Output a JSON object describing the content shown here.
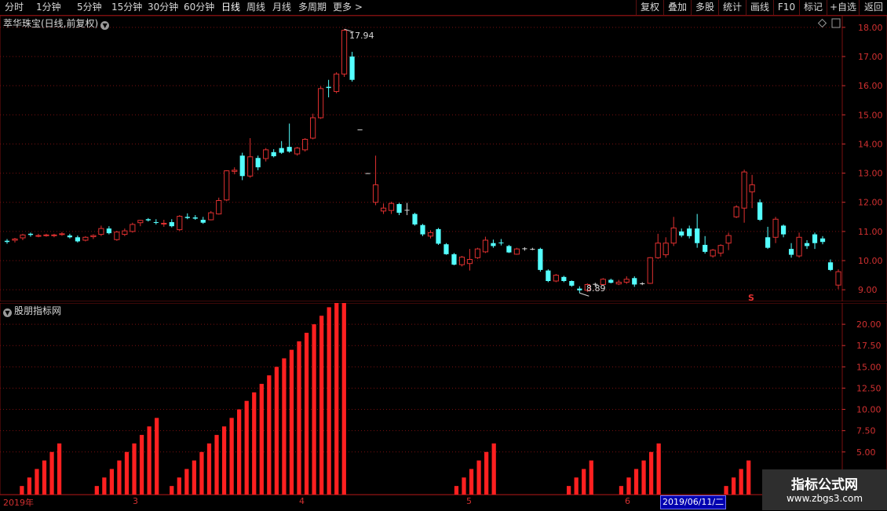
{
  "toolbar": {
    "periods": [
      "分时",
      "1分钟",
      "5分钟",
      "15分钟",
      "30分钟",
      "60分钟",
      "日线",
      "周线",
      "月线",
      "多周期",
      "更多 >"
    ],
    "active_period": "日线",
    "right_buttons": [
      "复权",
      "叠加",
      "多股",
      "统计",
      "画线",
      "F10",
      "标记",
      "+自选",
      "返回"
    ]
  },
  "main_panel": {
    "title": "萃华珠宝(日线,前复权)",
    "high_label": "17.94",
    "low_label": "8.89",
    "signal_mark": "S"
  },
  "indicator_panel": {
    "title": "股朋指标网"
  },
  "date_axis": {
    "labels": [
      "2019年",
      "3",
      "4",
      "5",
      "6"
    ],
    "cursor_date": "2019/06/11/二"
  },
  "watermark": {
    "line1": "指标公式网",
    "line2": "www.zbgs3.com"
  },
  "colors": {
    "up": "#e03030",
    "down": "#54ffff",
    "grid": "#7a1010",
    "axis_text": "#d03030",
    "indicator_bar": "#ff2020"
  },
  "chart_data": [
    {
      "type": "candlestick",
      "ylim": [
        8.6,
        18.4
      ],
      "y_ticks": [
        "18.00",
        "17.00",
        "16.00",
        "15.00",
        "14.00",
        "13.00",
        "12.00",
        "11.00",
        "10.00",
        "9.00"
      ],
      "candles": [
        {
          "o": 10.64,
          "h": 10.74,
          "l": 10.58,
          "c": 10.68,
          "dir": "down"
        },
        {
          "o": 10.7,
          "h": 10.78,
          "l": 10.62,
          "c": 10.74,
          "dir": "up"
        },
        {
          "o": 10.78,
          "h": 10.92,
          "l": 10.7,
          "c": 10.88,
          "dir": "up"
        },
        {
          "o": 10.92,
          "h": 10.96,
          "l": 10.82,
          "c": 10.88,
          "dir": "down"
        },
        {
          "o": 10.86,
          "h": 10.92,
          "l": 10.8,
          "c": 10.86,
          "dir": "up"
        },
        {
          "o": 10.88,
          "h": 10.92,
          "l": 10.82,
          "c": 10.88,
          "dir": "up"
        },
        {
          "o": 10.86,
          "h": 10.92,
          "l": 10.8,
          "c": 10.88,
          "dir": "up"
        },
        {
          "o": 10.92,
          "h": 10.98,
          "l": 10.85,
          "c": 10.9,
          "dir": "up"
        },
        {
          "o": 10.86,
          "h": 10.92,
          "l": 10.76,
          "c": 10.8,
          "dir": "down"
        },
        {
          "o": 10.66,
          "h": 10.86,
          "l": 10.62,
          "c": 10.8,
          "dir": "down"
        },
        {
          "o": 10.7,
          "h": 10.84,
          "l": 10.66,
          "c": 10.8,
          "dir": "up"
        },
        {
          "o": 10.82,
          "h": 10.9,
          "l": 10.74,
          "c": 10.86,
          "dir": "up"
        },
        {
          "o": 10.9,
          "h": 11.2,
          "l": 10.84,
          "c": 11.1,
          "dir": "up"
        },
        {
          "o": 11.1,
          "h": 11.18,
          "l": 10.9,
          "c": 10.94,
          "dir": "down"
        },
        {
          "o": 10.72,
          "h": 11.02,
          "l": 10.68,
          "c": 10.98,
          "dir": "up"
        },
        {
          "o": 10.9,
          "h": 11.1,
          "l": 10.84,
          "c": 11.02,
          "dir": "up"
        },
        {
          "o": 11.0,
          "h": 11.3,
          "l": 10.96,
          "c": 11.24,
          "dir": "up"
        },
        {
          "o": 11.3,
          "h": 11.4,
          "l": 11.18,
          "c": 11.38,
          "dir": "up"
        },
        {
          "o": 11.42,
          "h": 11.46,
          "l": 11.34,
          "c": 11.38,
          "dir": "down"
        },
        {
          "o": 11.32,
          "h": 11.42,
          "l": 11.24,
          "c": 11.32,
          "dir": "down"
        },
        {
          "o": 11.26,
          "h": 11.4,
          "l": 11.16,
          "c": 11.28,
          "dir": "up"
        },
        {
          "o": 11.32,
          "h": 11.42,
          "l": 11.14,
          "c": 11.18,
          "dir": "down"
        },
        {
          "o": 11.06,
          "h": 11.56,
          "l": 11.02,
          "c": 11.52,
          "dir": "up"
        },
        {
          "o": 11.5,
          "h": 11.62,
          "l": 11.42,
          "c": 11.46,
          "dir": "down"
        },
        {
          "o": 11.48,
          "h": 11.56,
          "l": 11.4,
          "c": 11.44,
          "dir": "down"
        },
        {
          "o": 11.3,
          "h": 11.5,
          "l": 11.26,
          "c": 11.4,
          "dir": "down"
        },
        {
          "o": 11.4,
          "h": 11.7,
          "l": 11.38,
          "c": 11.64,
          "dir": "up"
        },
        {
          "o": 11.6,
          "h": 12.16,
          "l": 11.58,
          "c": 12.06,
          "dir": "up"
        },
        {
          "o": 12.08,
          "h": 13.1,
          "l": 12.04,
          "c": 13.08,
          "dir": "up"
        },
        {
          "o": 13.06,
          "h": 13.2,
          "l": 12.96,
          "c": 13.1,
          "dir": "up"
        },
        {
          "o": 13.6,
          "h": 13.7,
          "l": 12.76,
          "c": 12.9,
          "dir": "down"
        },
        {
          "o": 12.9,
          "h": 14.2,
          "l": 12.84,
          "c": 13.56,
          "dir": "up"
        },
        {
          "o": 13.52,
          "h": 13.6,
          "l": 13.1,
          "c": 13.2,
          "dir": "down"
        },
        {
          "o": 13.5,
          "h": 13.86,
          "l": 13.4,
          "c": 13.8,
          "dir": "up"
        },
        {
          "o": 13.72,
          "h": 13.82,
          "l": 13.54,
          "c": 13.58,
          "dir": "down"
        },
        {
          "o": 13.7,
          "h": 14.1,
          "l": 13.66,
          "c": 13.86,
          "dir": "down"
        },
        {
          "o": 13.9,
          "h": 14.7,
          "l": 13.7,
          "c": 13.74,
          "dir": "down"
        },
        {
          "o": 13.66,
          "h": 13.9,
          "l": 13.6,
          "c": 13.86,
          "dir": "up"
        },
        {
          "o": 13.8,
          "h": 14.2,
          "l": 13.74,
          "c": 14.16,
          "dir": "up"
        },
        {
          "o": 14.2,
          "h": 15.04,
          "l": 14.16,
          "c": 14.9,
          "dir": "up"
        },
        {
          "o": 14.9,
          "h": 15.98,
          "l": 14.86,
          "c": 15.9,
          "dir": "up"
        },
        {
          "o": 15.92,
          "h": 16.2,
          "l": 15.6,
          "c": 15.96,
          "dir": "down"
        },
        {
          "o": 15.8,
          "h": 16.46,
          "l": 15.74,
          "c": 16.4,
          "dir": "up"
        },
        {
          "o": 16.4,
          "h": 17.94,
          "l": 16.3,
          "c": 17.9,
          "dir": "up"
        },
        {
          "o": 17.0,
          "h": 17.16,
          "l": 16.14,
          "c": 16.2,
          "dir": "down"
        },
        {
          "o": 14.5,
          "h": 14.5,
          "l": 14.5,
          "c": 14.5,
          "dir": "doji"
        },
        {
          "o": 13.0,
          "h": 13.0,
          "l": 13.0,
          "c": 13.0,
          "dir": "doji"
        },
        {
          "o": 12.0,
          "h": 13.6,
          "l": 11.9,
          "c": 12.6,
          "dir": "up"
        },
        {
          "o": 11.8,
          "h": 11.96,
          "l": 11.6,
          "c": 11.7,
          "dir": "up"
        },
        {
          "o": 11.72,
          "h": 12.02,
          "l": 11.6,
          "c": 11.96,
          "dir": "up"
        },
        {
          "o": 11.94,
          "h": 11.98,
          "l": 11.56,
          "c": 11.64,
          "dir": "down"
        },
        {
          "o": 11.74,
          "h": 11.98,
          "l": 11.56,
          "c": 11.74,
          "dir": "doji"
        },
        {
          "o": 11.6,
          "h": 11.64,
          "l": 11.2,
          "c": 11.24,
          "dir": "down"
        },
        {
          "o": 11.22,
          "h": 11.26,
          "l": 10.84,
          "c": 10.9,
          "dir": "down"
        },
        {
          "o": 10.84,
          "h": 11.04,
          "l": 10.76,
          "c": 10.96,
          "dir": "up"
        },
        {
          "o": 11.08,
          "h": 11.12,
          "l": 10.54,
          "c": 10.58,
          "dir": "down"
        },
        {
          "o": 10.56,
          "h": 10.6,
          "l": 10.2,
          "c": 10.22,
          "dir": "down"
        },
        {
          "o": 10.22,
          "h": 10.26,
          "l": 9.84,
          "c": 9.86,
          "dir": "down"
        },
        {
          "o": 9.86,
          "h": 10.16,
          "l": 9.8,
          "c": 10.12,
          "dir": "up"
        },
        {
          "o": 9.9,
          "h": 10.4,
          "l": 9.66,
          "c": 10.04,
          "dir": "up"
        },
        {
          "o": 10.1,
          "h": 10.44,
          "l": 10.06,
          "c": 10.4,
          "dir": "up"
        },
        {
          "o": 10.3,
          "h": 10.82,
          "l": 10.26,
          "c": 10.7,
          "dir": "up"
        },
        {
          "o": 10.6,
          "h": 10.72,
          "l": 10.44,
          "c": 10.5,
          "dir": "down"
        },
        {
          "o": 10.62,
          "h": 10.74,
          "l": 10.52,
          "c": 10.6,
          "dir": "down"
        },
        {
          "o": 10.5,
          "h": 10.54,
          "l": 10.26,
          "c": 10.28,
          "dir": "down"
        },
        {
          "o": 10.22,
          "h": 10.44,
          "l": 10.2,
          "c": 10.4,
          "dir": "up"
        },
        {
          "o": 10.4,
          "h": 10.46,
          "l": 10.34,
          "c": 10.42,
          "dir": "doji"
        },
        {
          "o": 10.4,
          "h": 10.44,
          "l": 10.36,
          "c": 10.4,
          "dir": "doji"
        },
        {
          "o": 10.4,
          "h": 10.44,
          "l": 9.62,
          "c": 9.68,
          "dir": "down"
        },
        {
          "o": 9.66,
          "h": 9.7,
          "l": 9.26,
          "c": 9.3,
          "dir": "down"
        },
        {
          "o": 9.3,
          "h": 9.54,
          "l": 9.26,
          "c": 9.5,
          "dir": "up"
        },
        {
          "o": 9.44,
          "h": 9.48,
          "l": 9.26,
          "c": 9.3,
          "dir": "down"
        },
        {
          "o": 9.3,
          "h": 9.32,
          "l": 9.1,
          "c": 9.14,
          "dir": "down"
        },
        {
          "o": 9.04,
          "h": 9.12,
          "l": 8.89,
          "c": 8.98,
          "dir": "down"
        },
        {
          "o": 8.98,
          "h": 9.22,
          "l": 8.92,
          "c": 9.18,
          "dir": "up"
        },
        {
          "o": 9.18,
          "h": 9.24,
          "l": 9.12,
          "c": 9.2,
          "dir": "doji"
        },
        {
          "o": 9.18,
          "h": 9.4,
          "l": 9.14,
          "c": 9.36,
          "dir": "up"
        },
        {
          "o": 9.34,
          "h": 9.38,
          "l": 9.22,
          "c": 9.24,
          "dir": "down"
        },
        {
          "o": 9.2,
          "h": 9.34,
          "l": 9.16,
          "c": 9.26,
          "dir": "up"
        },
        {
          "o": 9.26,
          "h": 9.46,
          "l": 9.2,
          "c": 9.36,
          "dir": "up"
        },
        {
          "o": 9.4,
          "h": 9.46,
          "l": 9.1,
          "c": 9.18,
          "dir": "down"
        },
        {
          "o": 9.22,
          "h": 9.26,
          "l": 9.16,
          "c": 9.22,
          "dir": "doji"
        },
        {
          "o": 9.22,
          "h": 10.12,
          "l": 9.2,
          "c": 10.1,
          "dir": "up"
        },
        {
          "o": 10.1,
          "h": 10.92,
          "l": 10.06,
          "c": 10.6,
          "dir": "up"
        },
        {
          "o": 10.2,
          "h": 10.8,
          "l": 10.1,
          "c": 10.6,
          "dir": "up"
        },
        {
          "o": 10.6,
          "h": 11.5,
          "l": 10.5,
          "c": 11.12,
          "dir": "up"
        },
        {
          "o": 11.0,
          "h": 11.1,
          "l": 10.8,
          "c": 10.86,
          "dir": "down"
        },
        {
          "o": 11.1,
          "h": 11.2,
          "l": 10.76,
          "c": 10.84,
          "dir": "down"
        },
        {
          "o": 11.1,
          "h": 11.6,
          "l": 10.44,
          "c": 10.6,
          "dir": "down"
        },
        {
          "o": 10.54,
          "h": 10.84,
          "l": 10.24,
          "c": 10.3,
          "dir": "down"
        },
        {
          "o": 10.16,
          "h": 10.4,
          "l": 10.1,
          "c": 10.36,
          "dir": "up"
        },
        {
          "o": 10.26,
          "h": 10.56,
          "l": 10.14,
          "c": 10.52,
          "dir": "up"
        },
        {
          "o": 10.6,
          "h": 10.96,
          "l": 10.36,
          "c": 10.86,
          "dir": "up"
        },
        {
          "o": 11.5,
          "h": 11.9,
          "l": 11.46,
          "c": 11.84,
          "dir": "up"
        },
        {
          "o": 11.8,
          "h": 13.12,
          "l": 11.3,
          "c": 13.04,
          "dir": "up"
        },
        {
          "o": 12.6,
          "h": 12.94,
          "l": 11.8,
          "c": 12.36,
          "dir": "up"
        },
        {
          "o": 12.0,
          "h": 12.1,
          "l": 11.36,
          "c": 11.4,
          "dir": "down"
        },
        {
          "o": 10.8,
          "h": 11.16,
          "l": 10.4,
          "c": 10.44,
          "dir": "down"
        },
        {
          "o": 10.8,
          "h": 11.5,
          "l": 10.6,
          "c": 11.42,
          "dir": "up"
        },
        {
          "o": 11.2,
          "h": 11.24,
          "l": 10.8,
          "c": 10.9,
          "dir": "down"
        },
        {
          "o": 10.4,
          "h": 10.6,
          "l": 10.1,
          "c": 10.2,
          "dir": "down"
        },
        {
          "o": 10.16,
          "h": 10.96,
          "l": 10.1,
          "c": 10.8,
          "dir": "up"
        },
        {
          "o": 10.6,
          "h": 10.7,
          "l": 10.4,
          "c": 10.5,
          "dir": "down"
        },
        {
          "o": 10.6,
          "h": 10.96,
          "l": 10.4,
          "c": 10.9,
          "dir": "down"
        },
        {
          "o": 10.76,
          "h": 10.84,
          "l": 10.56,
          "c": 10.64,
          "dir": "down"
        },
        {
          "o": 9.94,
          "h": 10.04,
          "l": 9.64,
          "c": 9.68,
          "dir": "down"
        },
        {
          "o": 9.16,
          "h": 9.7,
          "l": 9.02,
          "c": 9.62,
          "dir": "up"
        }
      ]
    },
    {
      "type": "bar",
      "ylim": [
        0,
        22.5
      ],
      "y_ticks": [
        "20.00",
        "17.50",
        "15.00",
        "12.50",
        "10.00",
        "7.50",
        "5.00"
      ],
      "values": [
        0,
        0,
        1,
        2,
        3,
        4,
        5,
        6,
        0,
        0,
        0,
        0,
        1,
        2,
        3,
        4,
        5,
        6,
        7,
        8,
        9,
        0,
        1,
        2,
        3,
        4,
        5,
        6,
        7,
        8,
        9,
        10,
        11,
        12,
        13,
        14,
        15,
        16,
        17,
        18,
        19,
        20,
        21,
        22,
        23,
        24,
        0,
        0,
        0,
        0,
        0,
        0,
        0,
        0,
        0,
        0,
        0,
        0,
        0,
        0,
        1,
        2,
        3,
        4,
        5,
        6,
        0,
        0,
        0,
        0,
        0,
        0,
        0,
        0,
        0,
        1,
        2,
        3,
        4,
        0,
        0,
        0,
        1,
        2,
        3,
        4,
        5,
        6,
        0,
        0,
        0,
        0,
        0,
        0,
        0,
        0,
        1,
        2,
        3,
        4,
        0,
        0,
        0,
        0,
        0,
        0,
        0,
        0,
        0,
        0,
        0,
        0
      ]
    }
  ]
}
